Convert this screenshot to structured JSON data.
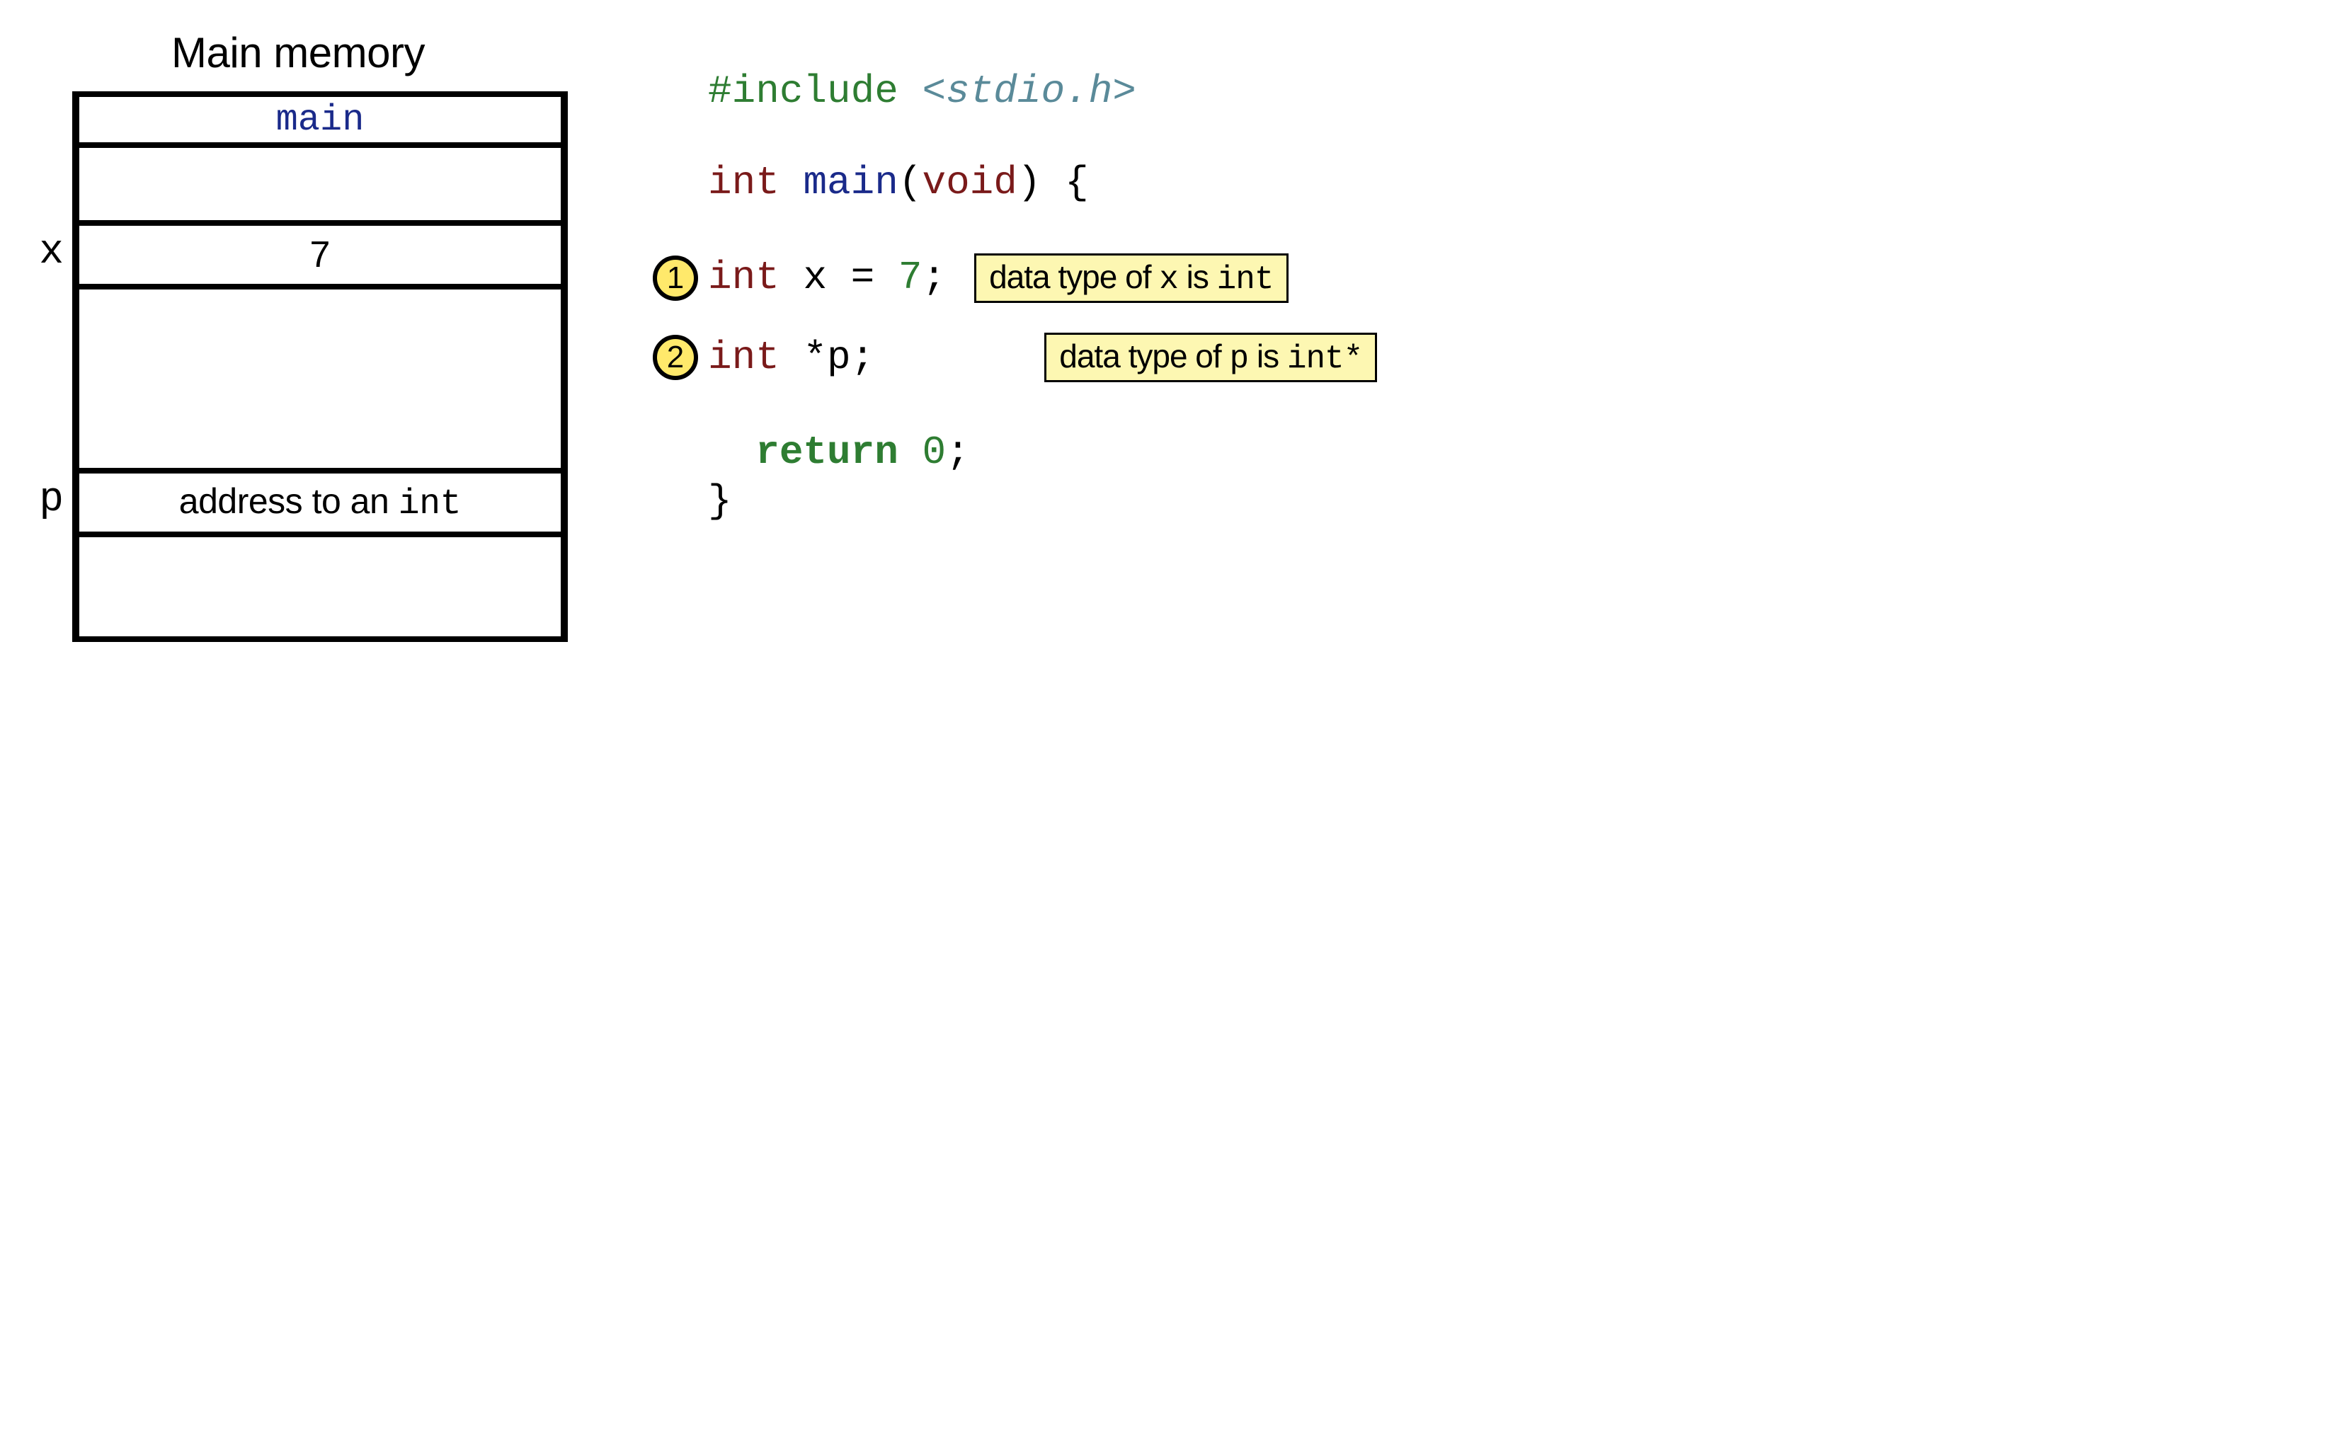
{
  "memory": {
    "title": "Main memory",
    "func_label": "main",
    "labels": {
      "x": "x",
      "p": "p"
    },
    "cells": {
      "x_value": "7",
      "p_value_pre": "address to an ",
      "p_value_mono": "int"
    }
  },
  "code": {
    "include_kw": "#include",
    "include_hdr": "<stdio.h>",
    "int": "int",
    "main": "main",
    "void": "void",
    "lbrace": "{",
    "rbrace": "}",
    "lparen": "(",
    "rparen": ")",
    "x": "x",
    "eq": "=",
    "seven": "7",
    "semi": ";",
    "star": "*",
    "p": "p",
    "return": "return",
    "zero": "0"
  },
  "steps": {
    "s1": "1",
    "s2": "2"
  },
  "annotations": {
    "a1_pre": "data type of ",
    "a1_var": "x",
    "a1_mid": " is ",
    "a1_type": "int",
    "a2_pre": "data type of ",
    "a2_var": "p",
    "a2_mid": " is ",
    "a2_type": "int*"
  }
}
